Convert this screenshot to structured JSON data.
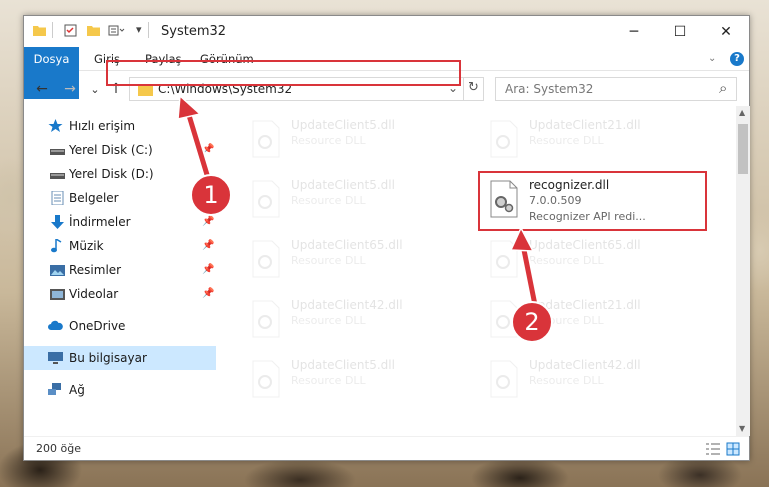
{
  "window": {
    "title": "System32",
    "controls": {
      "minimize": "─",
      "maximize": "☐",
      "close": "✕"
    }
  },
  "ribbon": {
    "tabs": [
      {
        "label": "Dosya"
      },
      {
        "label": "Giriş"
      },
      {
        "label": "Paylaş"
      },
      {
        "label": "Görünüm"
      }
    ],
    "help": "?"
  },
  "navigation": {
    "back": "←",
    "forward": "→",
    "recent": "⌄",
    "up": "↑",
    "address": "C:\\Windows\\System32",
    "refresh": "↻",
    "search_placeholder": "Ara: System32",
    "search_icon": "⌕"
  },
  "sidebar": {
    "items": [
      {
        "label": "Hızlı erişim",
        "icon": "star-icon",
        "pinned": false
      },
      {
        "label": "Yerel Disk (C:)",
        "icon": "drive-icon",
        "pinned": true
      },
      {
        "label": "Yerel Disk (D:)",
        "icon": "drive-icon",
        "pinned": false
      },
      {
        "label": "Belgeler",
        "icon": "documents-icon",
        "pinned": true
      },
      {
        "label": "İndirmeler",
        "icon": "download-icon",
        "pinned": true
      },
      {
        "label": "Müzik",
        "icon": "music-icon",
        "pinned": true
      },
      {
        "label": "Resimler",
        "icon": "pictures-icon",
        "pinned": true
      },
      {
        "label": "Videolar",
        "icon": "videos-icon",
        "pinned": true
      },
      {
        "label": "OneDrive",
        "icon": "cloud-icon",
        "pinned": false
      },
      {
        "label": "Bu bilgisayar",
        "icon": "computer-icon",
        "pinned": false,
        "selected": true
      },
      {
        "label": "Ağ",
        "icon": "network-icon",
        "pinned": false
      }
    ]
  },
  "files": {
    "ghost_col1": [
      {
        "name": "UpdateClient5.dll",
        "type": "Resource DLL"
      },
      {
        "name": "UpdateClient5.dll",
        "type": "Resource DLL"
      },
      {
        "name": "UpdateClient65.dll",
        "type": "Resource DLL"
      },
      {
        "name": "UpdateClient42.dll",
        "type": "Resource DLL"
      },
      {
        "name": "UpdateClient5.dll",
        "type": "Resource DLL"
      }
    ],
    "ghost_col2": [
      {
        "name": "UpdateClient21.dll",
        "type": "Resource DLL"
      },
      {
        "name": "UpdateClient65.dll",
        "type": "Resource DLL"
      },
      {
        "name": "UpdateClient21.dll",
        "type": "Resource DLL"
      },
      {
        "name": "UpdateClient42.dll",
        "type": "Resource DLL"
      }
    ],
    "highlighted": {
      "name": "recognizer.dll",
      "version": "7.0.0.509",
      "description": "Recognizer API redi..."
    }
  },
  "status": {
    "item_count": "200 öğe"
  },
  "annotations": {
    "step1": "1",
    "step2": "2",
    "color": "#d9343a"
  }
}
